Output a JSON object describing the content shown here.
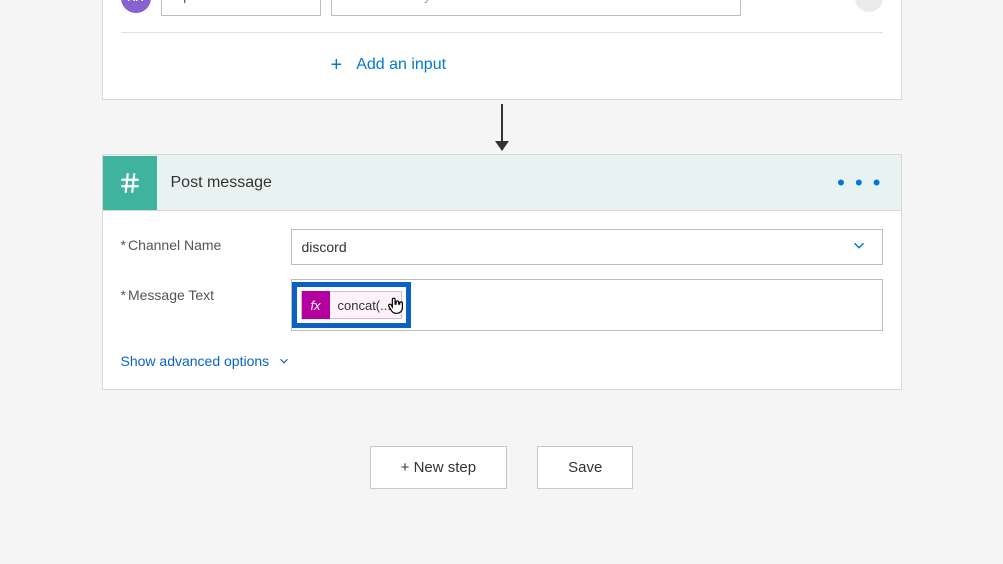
{
  "trigger_card": {
    "avatar_initials": "AA",
    "input_name": "Inputs",
    "input_placeholder": "Please enter your email",
    "add_input_label": "Add an input"
  },
  "action_card": {
    "title": "Post message",
    "fields": {
      "channel": {
        "label": "Channel Name",
        "value": "discord"
      },
      "message": {
        "label": "Message Text",
        "token_fx": "fx",
        "token_text": "concat(..."
      }
    },
    "show_advanced": "Show advanced options"
  },
  "footer": {
    "new_step": "+ New step",
    "save": "Save"
  }
}
